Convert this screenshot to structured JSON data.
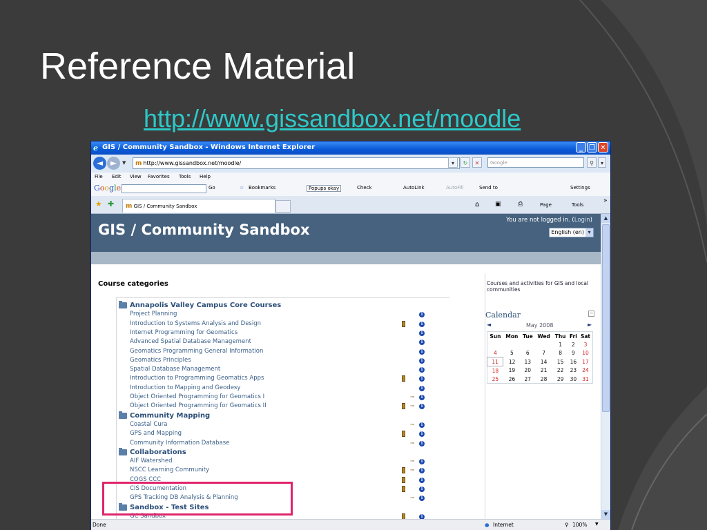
{
  "slide": {
    "title": "Reference Material",
    "link": "http://www.gissandbox.net/moodle"
  },
  "window": {
    "title": "GIS / Community Sandbox - Windows Internet Explorer",
    "address": "http://www.gissandbox.net/moodle/",
    "search_placeholder": "Google"
  },
  "menubar": [
    "File",
    "Edit",
    "View",
    "Favorites",
    "Tools",
    "Help"
  ],
  "google_toolbar": {
    "logo": "Google",
    "go": "Go",
    "bookmarks": "Bookmarks",
    "popups": "Popups okay",
    "check": "Check",
    "autolink": "AutoLink",
    "autofill": "AutoFill",
    "sendto": "Send to",
    "settings": "Settings"
  },
  "tabbar": {
    "tab_title": "GIS / Community Sandbox",
    "page": "Page",
    "tools": "Tools",
    "overflow": "»"
  },
  "page": {
    "site_title": "GIS / Community Sandbox",
    "login_text": "You are not logged in. (",
    "login_link": "Login",
    "login_close": ")",
    "language": "English (en)",
    "course_categories_heading": "Course categories",
    "summary": "Courses and activities for GIS and local communities"
  },
  "course_list": [
    {
      "text": "Annapolis Valley Campus Core Courses",
      "kind": "category"
    },
    {
      "text": "Project Planning",
      "kind": "course",
      "info": true
    },
    {
      "text": "Introduction to Systems Analysis and Design",
      "kind": "course",
      "door": true,
      "info": true
    },
    {
      "text": "Internet Programming for Geomatics",
      "kind": "course",
      "info": true
    },
    {
      "text": "Advanced Spatial Database Management",
      "kind": "course",
      "info": true
    },
    {
      "text": "Geomatics Programming General Information",
      "kind": "course",
      "info": true
    },
    {
      "text": "Geomatics Principles",
      "kind": "course",
      "info": true
    },
    {
      "text": "Spatial Database Management",
      "kind": "course",
      "info": true
    },
    {
      "text": "Introduction to Programming Geomatics Apps",
      "kind": "course",
      "door": true,
      "info": true
    },
    {
      "text": "Introduction to Mapping and Geodesy",
      "kind": "course",
      "info": true
    },
    {
      "text": "Object Oriented Programming for Geomatics I",
      "kind": "course",
      "key": true,
      "info": true
    },
    {
      "text": "Object Oriented Programming for Geomatics II",
      "kind": "course",
      "door": true,
      "key": true,
      "info": true
    },
    {
      "text": "Community Mapping",
      "kind": "category"
    },
    {
      "text": "Coastal Cura",
      "kind": "course",
      "key": true,
      "info": true
    },
    {
      "text": "GPS and Mapping",
      "kind": "course",
      "door": true,
      "info": true
    },
    {
      "text": "Community Information Database",
      "kind": "course",
      "key": true,
      "info": true
    },
    {
      "text": "Collaborations",
      "kind": "category"
    },
    {
      "text": "AIF Watershed",
      "kind": "course",
      "key": true,
      "info": true
    },
    {
      "text": "NSCC Learning Community",
      "kind": "course",
      "door": true,
      "key": true,
      "info": true
    },
    {
      "text": "COGS CCC",
      "kind": "course",
      "door": true,
      "info": true
    },
    {
      "text": "CIS Documentation",
      "kind": "course",
      "door": true,
      "info": true
    },
    {
      "text": "GPS Tracking DB Analysis & Planning",
      "kind": "course",
      "key": true,
      "info": true
    },
    {
      "text": "Sandbox - Test Sites",
      "kind": "category"
    },
    {
      "text": "GC Sandbox",
      "kind": "course",
      "door": true,
      "info": true
    }
  ],
  "calendar": {
    "title": "Calendar",
    "month": "May 2008",
    "prev": "◄",
    "next": "►",
    "headers": [
      "Sun",
      "Mon",
      "Tue",
      "Wed",
      "Thu",
      "Fri",
      "Sat"
    ],
    "weeks": [
      [
        "",
        "",
        "",
        "",
        "1",
        "2",
        "3"
      ],
      [
        "4",
        "5",
        "6",
        "7",
        "8",
        "9",
        "10"
      ],
      [
        "11",
        "12",
        "13",
        "14",
        "15",
        "16",
        "17"
      ],
      [
        "18",
        "19",
        "20",
        "21",
        "22",
        "23",
        "24"
      ],
      [
        "25",
        "26",
        "27",
        "28",
        "29",
        "30",
        "31"
      ]
    ],
    "today": "11"
  },
  "statusbar": {
    "left": "Done",
    "zone": "Internet",
    "zoom": "100%"
  },
  "colors": {
    "slide_bg": "#3b3b3b",
    "link": "#2ec8c8",
    "header_bg": "#46627e",
    "highlight": "#e0246a"
  }
}
